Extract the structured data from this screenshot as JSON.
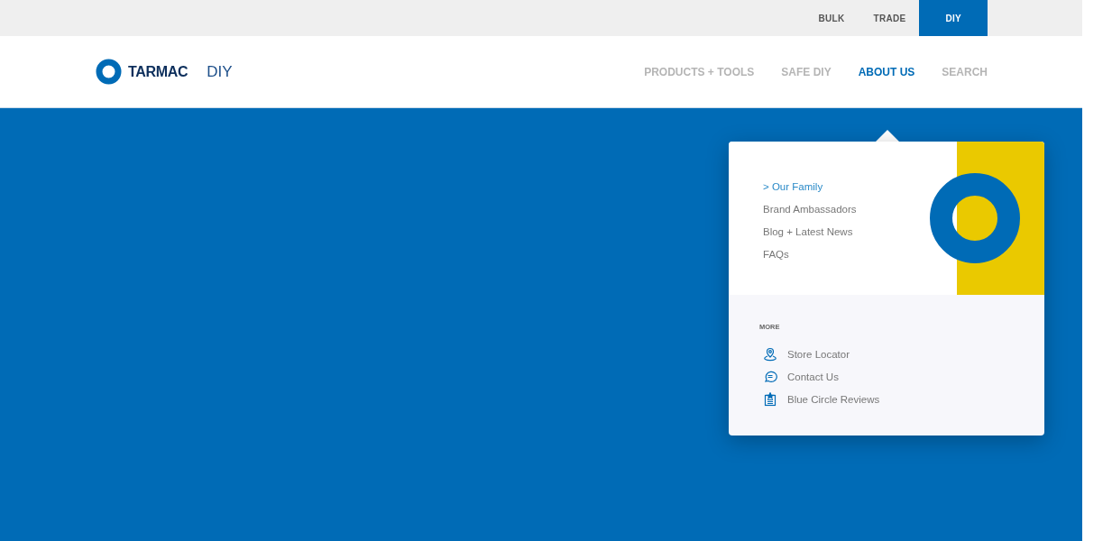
{
  "site_tabs": [
    {
      "label": "BULK",
      "selected": false
    },
    {
      "label": "TRADE",
      "selected": false
    },
    {
      "label": "DIY",
      "selected": true
    }
  ],
  "logo": {
    "brand": "TARMAC",
    "section": "DIY"
  },
  "nav": [
    {
      "label": "PRODUCTS + TOOLS",
      "selected": false
    },
    {
      "label": "SAFE DIY",
      "selected": false
    },
    {
      "label": "ABOUT US",
      "selected": true
    },
    {
      "label": "SEARCH",
      "selected": false
    }
  ],
  "dropdown": {
    "items": [
      {
        "label": "> Our Family",
        "selected": true
      },
      {
        "label": "Brand Ambassadors",
        "selected": false
      },
      {
        "label": "Blog + Latest News",
        "selected": false
      },
      {
        "label": "FAQs",
        "selected": false
      }
    ],
    "more_heading": "MORE",
    "more_links": [
      {
        "kind": "pin",
        "label": "Store Locator"
      },
      {
        "kind": "chat",
        "label": "Contact Us"
      },
      {
        "kind": "clipboard",
        "label": "Blue Circle Reviews"
      }
    ]
  }
}
